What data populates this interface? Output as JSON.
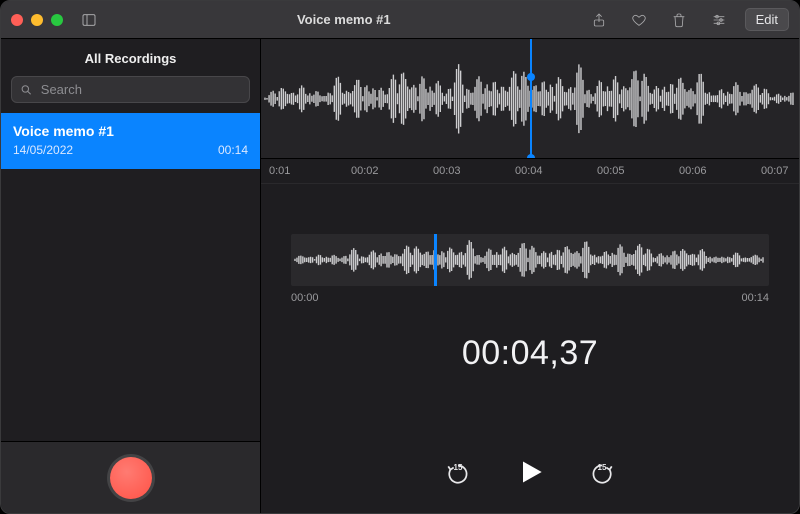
{
  "window": {
    "title": "Voice memo #1"
  },
  "titlebar_actions": {
    "share": "share-icon",
    "favorite": "heart-icon",
    "delete": "trash-icon",
    "settings": "sliders-icon",
    "edit_label": "Edit"
  },
  "sidebar": {
    "header": "All Recordings",
    "search_placeholder": "Search",
    "recordings": [
      {
        "title": "Voice memo #1",
        "date": "14/05/2022",
        "duration": "00:14",
        "selected": true
      }
    ]
  },
  "main": {
    "ruler_ticks": [
      "0:01",
      "00:02",
      "00:03",
      "00:04",
      "00:05",
      "00:06",
      "00:07"
    ],
    "trim": {
      "start_label": "00:00",
      "end_label": "00:14",
      "playhead_frac": 0.3
    },
    "time_display": "00:04,37",
    "controls": {
      "skip_back_seconds": "15",
      "skip_forward_seconds": "15"
    },
    "playhead_frac": 0.5
  },
  "colors": {
    "accent": "#0a84ff",
    "record": "#ff5246"
  }
}
